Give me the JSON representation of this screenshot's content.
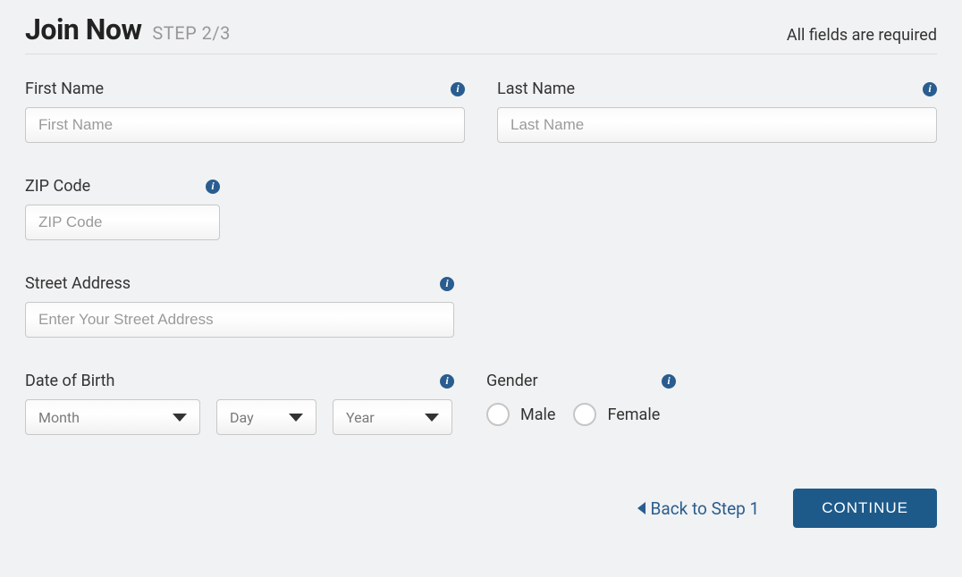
{
  "header": {
    "title": "Join Now",
    "step": "STEP 2/3",
    "requiredNote": "All fields are required"
  },
  "fields": {
    "firstName": {
      "label": "First Name",
      "placeholder": "First Name"
    },
    "lastName": {
      "label": "Last Name",
      "placeholder": "Last Name"
    },
    "zip": {
      "label": "ZIP Code",
      "placeholder": "ZIP Code"
    },
    "street": {
      "label": "Street Address",
      "placeholder": "Enter Your Street Address"
    },
    "dob": {
      "label": "Date of Birth",
      "month": "Month",
      "day": "Day",
      "year": "Year"
    },
    "gender": {
      "label": "Gender",
      "options": {
        "male": "Male",
        "female": "Female"
      }
    }
  },
  "footer": {
    "backLabel": "Back to Step 1",
    "continueLabel": "CONTINUE"
  },
  "colors": {
    "accent": "#1d5a8a",
    "link": "#2a5d8f"
  }
}
